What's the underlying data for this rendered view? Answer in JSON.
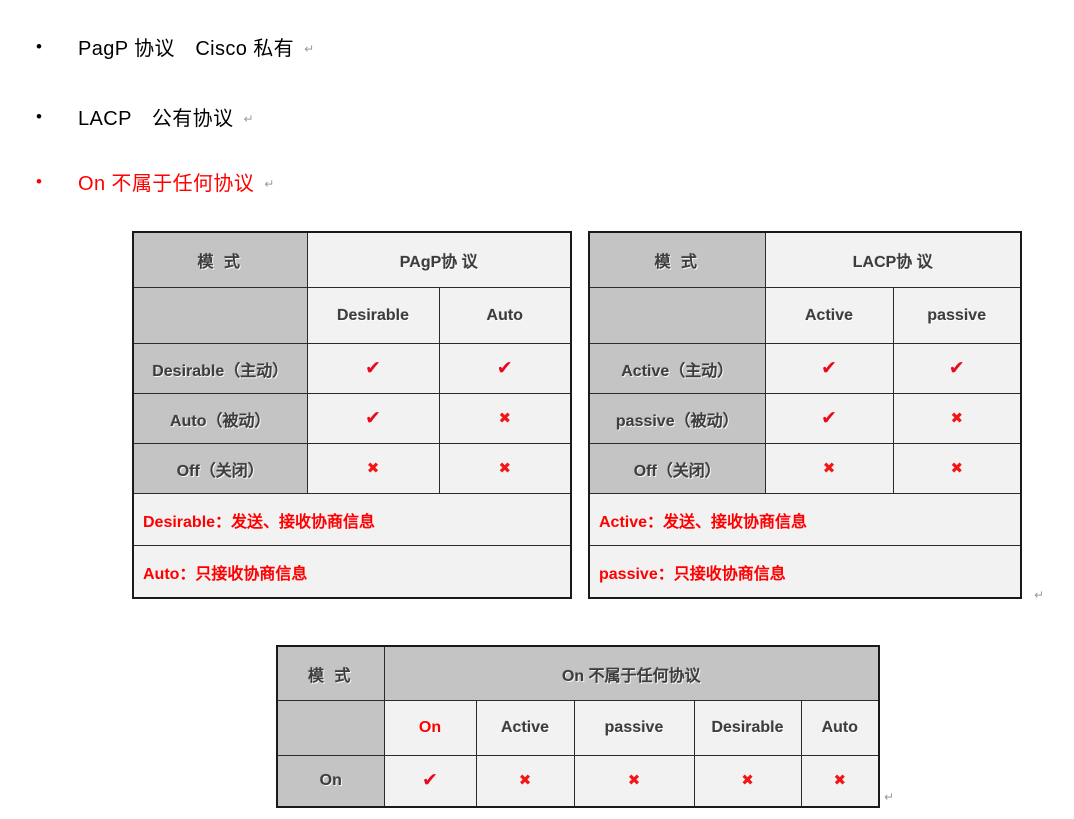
{
  "bullets": [
    {
      "marker": "•",
      "text": "PagP 协议　Cisco 私有",
      "color": "black",
      "pilcrow": "↵"
    },
    {
      "marker": "•",
      "text": "LACP　公有协议",
      "color": "black",
      "pilcrow": "↵"
    },
    {
      "marker": "•",
      "text": "On 不属于任何协议",
      "color": "red",
      "pilcrow": "↵"
    }
  ],
  "glyphs": {
    "check": "✔",
    "cross": "✖",
    "pilcrow": "↵"
  },
  "colors": {
    "header_gray": "#c4c4c4",
    "cell_light": "#f2f2f2",
    "red": "#ff0000",
    "check_red": "#e8091a",
    "text_dark": "#3d3d3d"
  },
  "table_pagp": {
    "mode_label": "模 式",
    "protocol_label": "PAgP协 议",
    "columns": [
      "Desirable",
      "Auto"
    ],
    "rows": [
      {
        "label": "Desirable（主动）",
        "cells": [
          "check",
          "check"
        ]
      },
      {
        "label": "Auto（被动）",
        "cells": [
          "check",
          "cross"
        ]
      },
      {
        "label": "Off（关闭）",
        "cells": [
          "cross",
          "cross"
        ]
      }
    ],
    "notes": [
      "Desirable：发送、接收协商信息",
      "Auto：只接收协商信息"
    ]
  },
  "table_lacp": {
    "mode_label": "模 式",
    "protocol_label": "LACP协 议",
    "columns": [
      "Active",
      "passive"
    ],
    "rows": [
      {
        "label": "Active（主动）",
        "cells": [
          "check",
          "check"
        ]
      },
      {
        "label": "passive（被动）",
        "cells": [
          "check",
          "cross"
        ]
      },
      {
        "label": "Off（关闭）",
        "cells": [
          "cross",
          "cross"
        ]
      }
    ],
    "notes": [
      "Active：发送、接收协商信息",
      "passive：只接收协商信息"
    ]
  },
  "table_on": {
    "mode_label": "模 式",
    "protocol_label": "On 不属于任何协议",
    "columns": [
      "On",
      "Active",
      "passive",
      "Desirable",
      "Auto"
    ],
    "rows": [
      {
        "label": "On",
        "cells": [
          "check",
          "cross",
          "cross",
          "cross",
          "cross"
        ]
      }
    ]
  }
}
